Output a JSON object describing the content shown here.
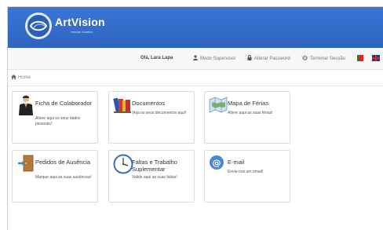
{
  "header": {
    "brand": "ArtVision",
    "brand_sub": "Human Solution"
  },
  "topbar": {
    "greeting": "Olá, Lara Lapa",
    "supervisor": "Modo Supervisor",
    "password": "Alterar Password",
    "logout": "Terminar Sessão"
  },
  "breadcrumb": {
    "home": "Home"
  },
  "cards": [
    {
      "title": "Ficha de Colaborador",
      "desc": "Altere aqui os seus dados pessoais!"
    },
    {
      "title": "Documentos",
      "desc": "Veja os seus documentos aqui!"
    },
    {
      "title": "Mapa de Férias",
      "desc": "Altere aqui as suas férias!"
    },
    {
      "title": "Pedidos de Ausência",
      "desc": "Marque aqui as suas ausências!"
    },
    {
      "title": "Faltas e Trabalho Suplementar",
      "desc": "Valide aqui as suas faltas!"
    },
    {
      "title": "E-mail",
      "desc": "Envie-nos um email!"
    }
  ],
  "colors": {
    "header_blue": "#2f64c0",
    "topbar": "#f7f7f7"
  }
}
